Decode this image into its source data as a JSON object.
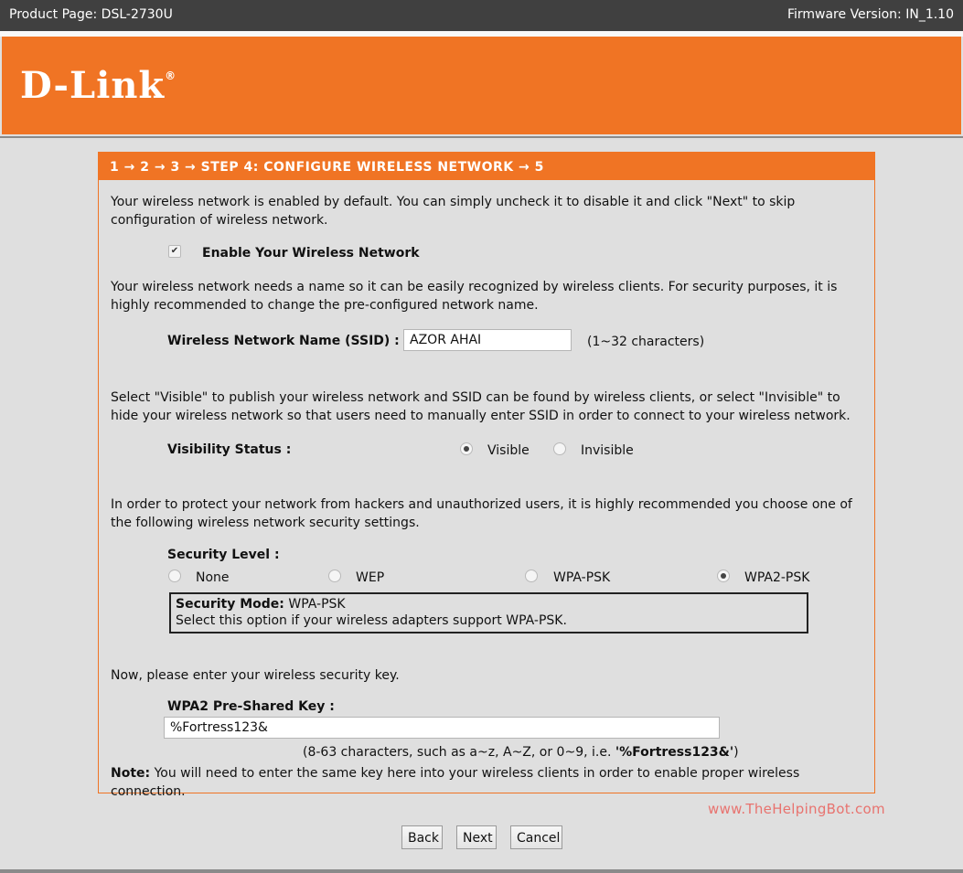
{
  "header": {
    "product": "Product Page: DSL-2730U",
    "firmware": "Firmware Version: IN_1.10"
  },
  "brand": {
    "logo_text": "D-Link",
    "logo_mark": "®",
    "accent": "#f07424"
  },
  "wizard": {
    "title": "1 → 2 → 3 → STEP 4: CONFIGURE WIRELESS NETWORK → 5",
    "intro": "Your wireless network is enabled by default. You can simply uncheck it to disable it and click \"Next\" to skip configuration of wireless network.",
    "enable_label": "Enable Your Wireless Network",
    "enable_checked": true,
    "ssid_intro": "Your wireless network needs a name so it can be easily recognized by wireless clients. For security purposes, it is highly recommended to change the pre-configured network name.",
    "ssid_label": "Wireless Network Name (SSID) :",
    "ssid_value": "AZOR AHAI",
    "ssid_hint": "(1~32 characters)",
    "visibility_intro": "Select \"Visible\" to publish your wireless network and SSID can be found by wireless clients, or select \"Invisible\" to hide your wireless network so that users need to manually enter SSID in order to connect to your wireless network.",
    "visibility_label": "Visibility Status :",
    "visibility_options": [
      "Visible",
      "Invisible"
    ],
    "visibility_selected": "Visible",
    "security_intro": "In order to protect your network from hackers and unauthorized users, it is highly recommended you choose one of the following wireless network security settings.",
    "security_label": "Security Level :",
    "security_options": [
      "None",
      "WEP",
      "WPA-PSK",
      "WPA2-PSK"
    ],
    "security_selected": "WPA2-PSK",
    "mode_title": "Security Mode:",
    "mode_value": "WPA-PSK",
    "mode_desc": "Select this option if your wireless adapters support WPA-PSK.",
    "key_intro": "Now, please enter your wireless security key.",
    "key_label": "WPA2 Pre-Shared Key :",
    "key_value": "%Fortress123&",
    "key_hint_prefix": "(8-63 characters, such as a~z, A~Z, or 0~9, i.e. ",
    "key_hint_example": "'%Fortress123&'",
    "key_hint_suffix": ")",
    "note_label": "Note:",
    "note_text": " You will need to enter the same key here into your wireless clients in order to enable proper wireless connection."
  },
  "watermark": "www.TheHelpingBot.com",
  "buttons": {
    "back": "Back",
    "next": "Next",
    "cancel": "Cancel"
  }
}
